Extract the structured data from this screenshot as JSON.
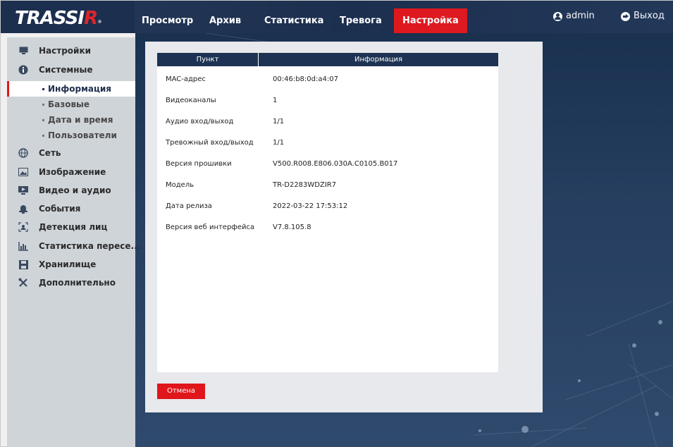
{
  "app": {
    "logo_main": "TRASSI",
    "logo_accent": "R"
  },
  "topnav": {
    "items": [
      {
        "label": "Просмотр",
        "active": false
      },
      {
        "label": "Архив",
        "active": false
      },
      {
        "label": "Статистика",
        "active": false
      },
      {
        "label": "Тревога",
        "active": false
      },
      {
        "label": "Настройка",
        "active": true
      }
    ],
    "user": {
      "label": "admin",
      "icon": "user-circle-icon"
    },
    "logout": {
      "label": "Выход",
      "icon": "logout-arrow-icon"
    }
  },
  "sidebar": {
    "items": [
      {
        "label": "Настройки",
        "icon": "monitor-icon"
      },
      {
        "label": "Системные",
        "icon": "info-circle-icon",
        "children": [
          {
            "label": "Информация",
            "active": true
          },
          {
            "label": "Базовые",
            "active": false
          },
          {
            "label": "Дата и время",
            "active": false
          },
          {
            "label": "Пользователи",
            "active": false
          }
        ]
      },
      {
        "label": "Сеть",
        "icon": "globe-icon"
      },
      {
        "label": "Изображение",
        "icon": "image-icon"
      },
      {
        "label": "Видео и аудио",
        "icon": "video-icon"
      },
      {
        "label": "События",
        "icon": "alarm-bell-icon"
      },
      {
        "label": "Детекция лиц",
        "icon": "face-detect-icon"
      },
      {
        "label": "Статистика пересе...",
        "icon": "bar-stats-icon"
      },
      {
        "label": "Хранилище",
        "icon": "floppy-disk-icon"
      },
      {
        "label": "Дополнительно",
        "icon": "tools-icon"
      }
    ]
  },
  "info_table": {
    "headers": [
      "Пункт",
      "Информация"
    ],
    "rows": [
      {
        "key": "MAC-адрес",
        "value": "00:46:b8:0d:a4:07"
      },
      {
        "key": "Видеоканалы",
        "value": "1"
      },
      {
        "key": "Аудио вход/выход",
        "value": "1/1"
      },
      {
        "key": "Тревожный вход/выход",
        "value": "1/1"
      },
      {
        "key": "Версия прошивки",
        "value": "V500.R008.E806.030A.C0105.B017"
      },
      {
        "key": "Модель",
        "value": "TR-D2283WDZIR7"
      },
      {
        "key": "Дата релиза",
        "value": "2022-03-22 17:53:12"
      },
      {
        "key": "Версия веб интерфейса",
        "value": "V7.8.105.8"
      }
    ]
  },
  "actions": {
    "cancel_label": "Отмена"
  },
  "colors": {
    "nav_bg": "#1c2f4f",
    "accent_red": "#e0161c",
    "sidebar_bg": "#cfd4d9",
    "table_header": "#1e3353"
  }
}
